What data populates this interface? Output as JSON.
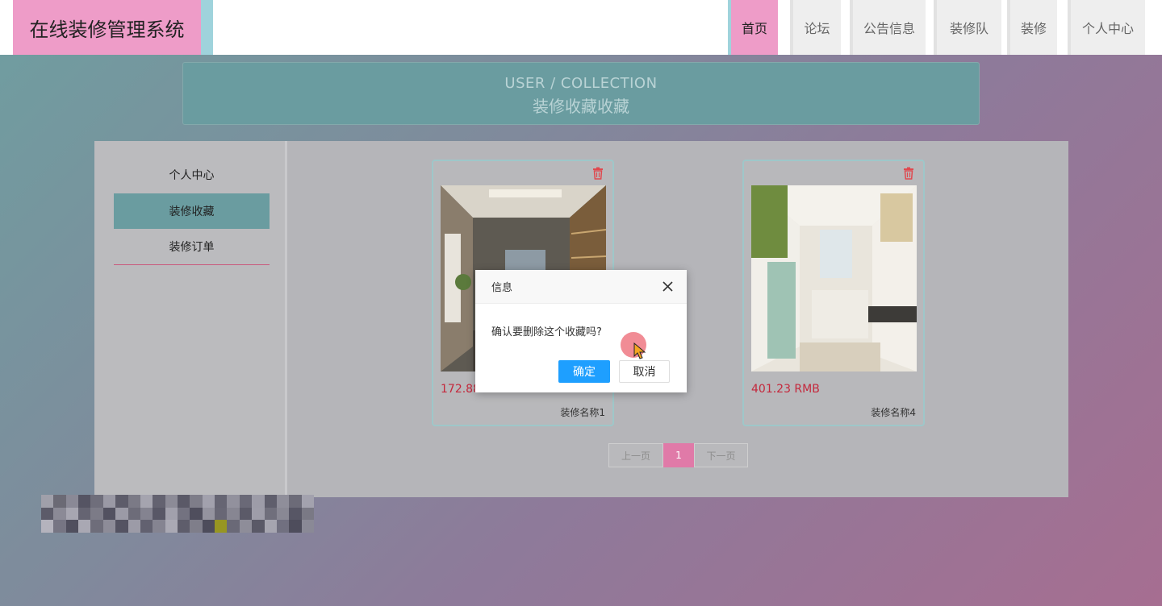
{
  "header": {
    "logo": "在线装修管理系统",
    "nav": [
      "首页",
      "论坛",
      "公告信息",
      "装修队",
      "装修",
      "个人中心"
    ]
  },
  "banner": {
    "en": "USER / COLLECTION",
    "cn": "装修收藏收藏"
  },
  "sidebar": {
    "items": [
      "个人中心",
      "装修收藏",
      "装修订单"
    ],
    "active": "装修收藏"
  },
  "cards": [
    {
      "price": "172.88 RMB",
      "name": "装修名称1",
      "delete_icon": "trash-icon"
    },
    {
      "price": "401.23 RMB",
      "name": "装修名称4",
      "delete_icon": "trash-icon"
    }
  ],
  "pager": {
    "prev": "上一页",
    "current": "1",
    "next": "下一页"
  },
  "modal": {
    "title": "信息",
    "message": "确认要删除这个收藏吗?",
    "ok": "确定",
    "cancel": "取消"
  },
  "colors": {
    "logo_bg": "#ee9cc8",
    "accent_teal": "#6a9ca0",
    "price_red": "#c4283c",
    "primary_button": "#1e9fff"
  }
}
